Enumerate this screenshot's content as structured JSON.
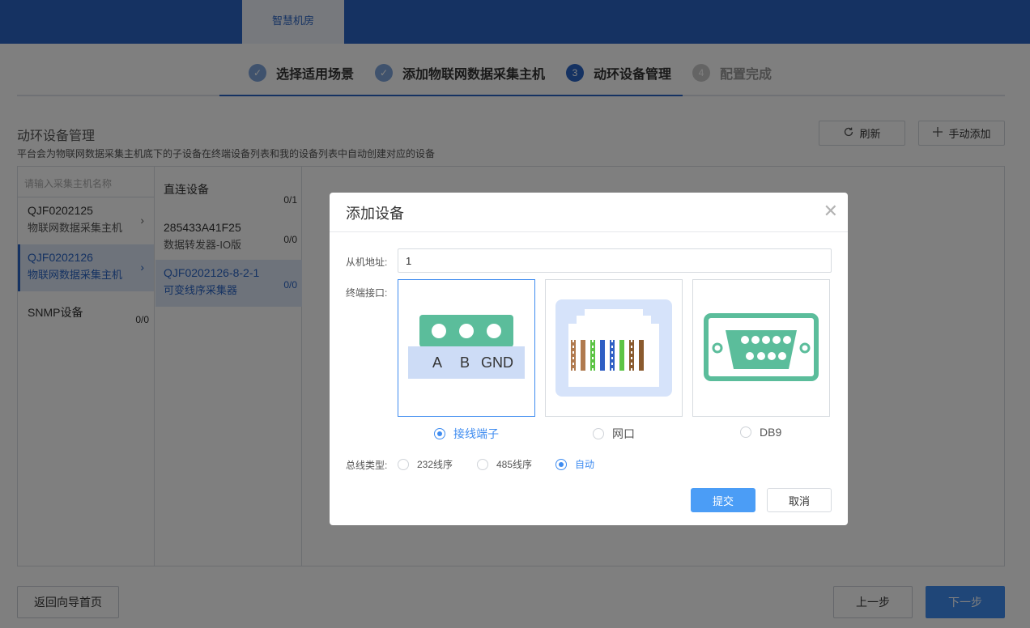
{
  "header": {
    "tab_label": "智慧机房"
  },
  "steps": [
    {
      "label": "选择适用场景",
      "state": "done",
      "badge": "✓"
    },
    {
      "label": "添加物联网数据采集主机",
      "state": "done",
      "badge": "✓"
    },
    {
      "label": "动环设备管理",
      "state": "active",
      "badge": "3"
    },
    {
      "label": "配置完成",
      "state": "todo",
      "badge": "4"
    }
  ],
  "section": {
    "title": "动环设备管理",
    "description": "平台会为物联网数据采集主机底下的子设备在终端设备列表和我的设备列表中自动创建对应的设备",
    "refresh_label": "刷新",
    "add_label": "手动添加"
  },
  "host_list": {
    "search_placeholder": "请输入采集主机名称",
    "items": [
      {
        "name": "QJF0202125",
        "sub": "物联网数据采集主机"
      },
      {
        "name": "QJF0202126",
        "sub": "物联网数据采集主机"
      },
      {
        "name": "SNMP设备",
        "count": "0/0"
      }
    ]
  },
  "device_list": {
    "items": [
      {
        "name": "直连设备",
        "count": "0/1"
      },
      {
        "name": "285433A41F25",
        "sub": "数据转发器-IO版",
        "count": "0/0"
      },
      {
        "name": "QJF0202126-8-2-1",
        "sub": "可变线序采集器",
        "count": "0/0"
      }
    ]
  },
  "footer": {
    "back_home": "返回向导首页",
    "prev": "上一步",
    "next": "下一步"
  },
  "modal": {
    "title": "添加设备",
    "slave_address_label": "从机地址:",
    "slave_address_value": "1",
    "terminal_label": "终端接口:",
    "terminal_options": [
      {
        "label": "接线端子",
        "selected": true,
        "icon": "terminal-block-icon"
      },
      {
        "label": "网口",
        "selected": false,
        "icon": "rj45-port-icon"
      },
      {
        "label": "DB9",
        "selected": false,
        "icon": "db9-connector-icon"
      }
    ],
    "terminal_diagram": {
      "pin_a": "A",
      "pin_b": "B",
      "pin_gnd": "GND"
    },
    "bus_label": "总线类型:",
    "bus_options": [
      {
        "label": "232线序",
        "selected": false
      },
      {
        "label": "485线序",
        "selected": false
      },
      {
        "label": "自动",
        "selected": true
      }
    ],
    "submit": "提交",
    "cancel": "取消"
  },
  "colors": {
    "brand": "#2a64c5",
    "primary_button": "#4b9df6",
    "terminal_green": "#5bbd9b"
  }
}
